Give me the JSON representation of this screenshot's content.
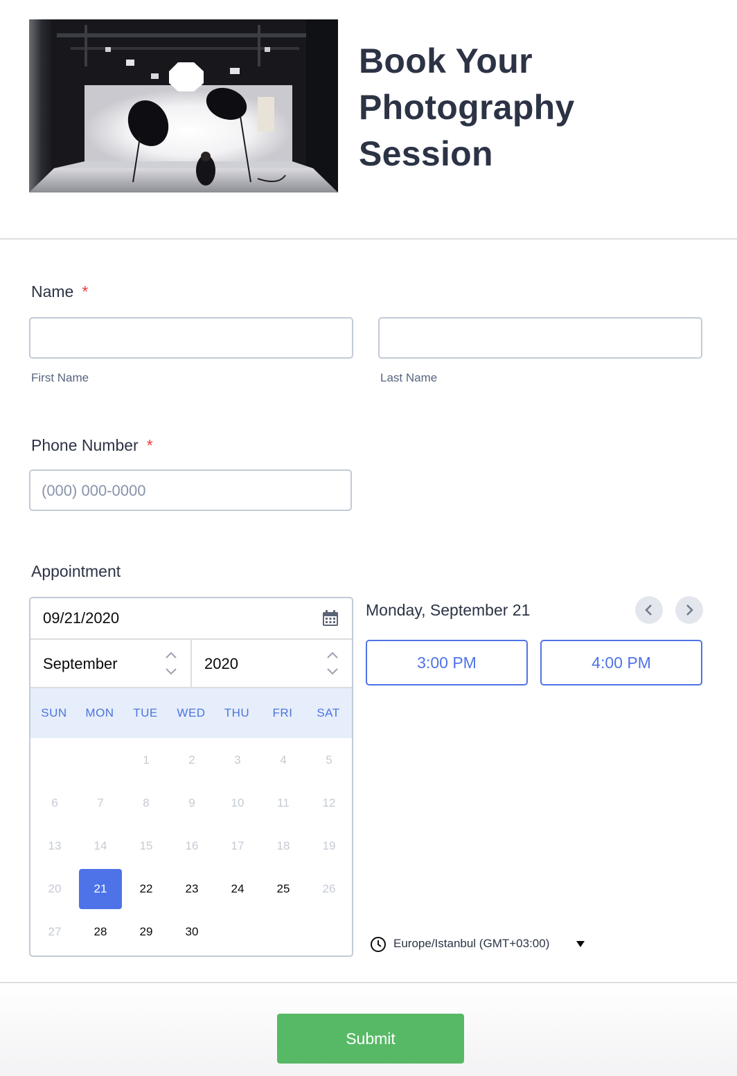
{
  "header": {
    "title_line1": "Book Your",
    "title_line2": "Photography",
    "title_line3": "Session",
    "image": "photography-studio-image"
  },
  "name": {
    "label": "Name",
    "required_mark": "*",
    "first_sublabel": "First Name",
    "last_sublabel": "Last Name",
    "first_value": "",
    "last_value": ""
  },
  "phone": {
    "label": "Phone Number",
    "required_mark": "*",
    "placeholder": "(000) 000-0000"
  },
  "appointment": {
    "label": "Appointment",
    "date_value": "09/21/2020",
    "month": "September",
    "year": "2020",
    "weekdays": [
      "SUN",
      "MON",
      "TUE",
      "WED",
      "THU",
      "FRI",
      "SAT"
    ],
    "days": [
      [
        "",
        "",
        "1",
        "2",
        "3",
        "4",
        "5"
      ],
      [
        "6",
        "7",
        "8",
        "9",
        "10",
        "11",
        "12"
      ],
      [
        "13",
        "14",
        "15",
        "16",
        "17",
        "18",
        "19"
      ],
      [
        "20",
        "21",
        "22",
        "23",
        "24",
        "25",
        "26"
      ],
      [
        "27",
        "28",
        "29",
        "30",
        "",
        "",
        ""
      ]
    ],
    "available_days": [
      "21",
      "22",
      "23",
      "24",
      "25",
      "28",
      "29",
      "30"
    ],
    "selected_day": "21",
    "selected_date_heading": "Monday, September 21",
    "time_slots": [
      "3:00 PM",
      "4:00 PM"
    ],
    "timezone": "Europe/Istanbul (GMT+03:00)",
    "accent_color": "#4e73e8"
  },
  "footer": {
    "submit_label": "Submit",
    "submit_color": "#57b965"
  }
}
